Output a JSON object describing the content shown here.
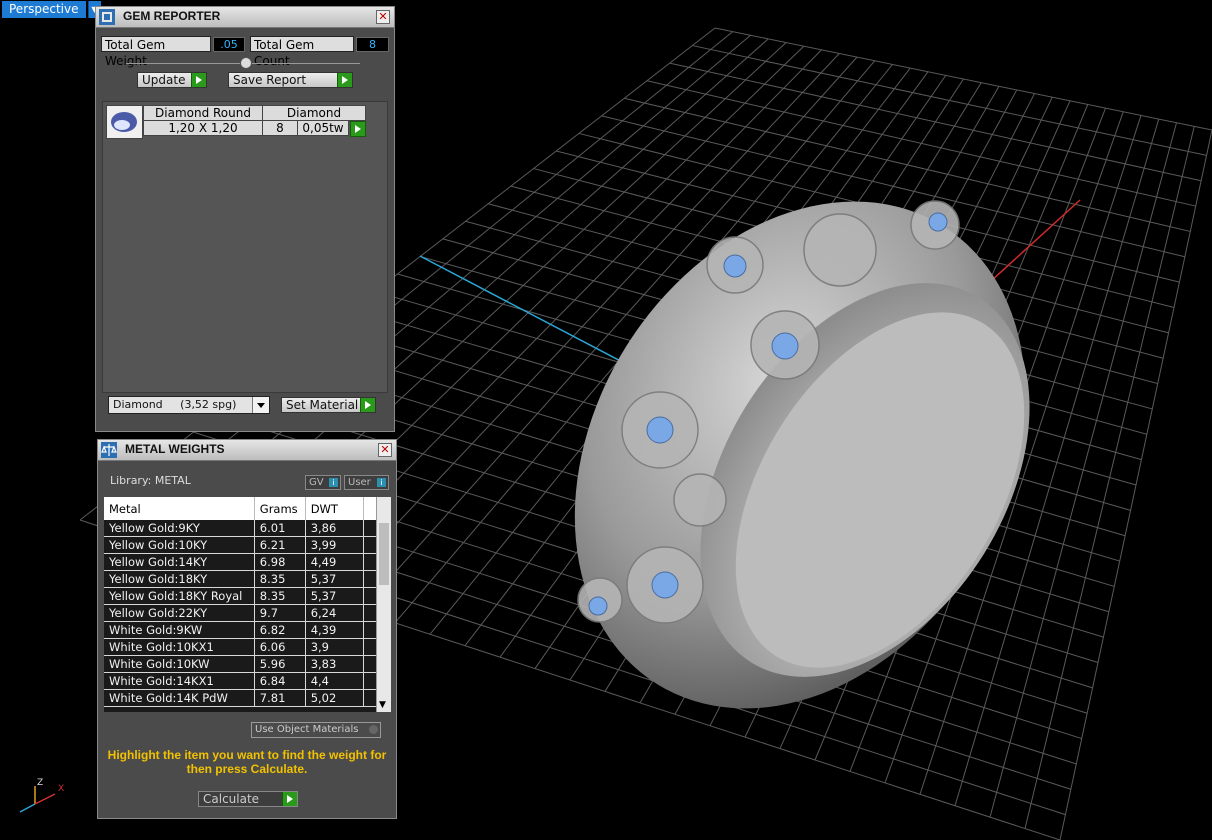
{
  "viewport": {
    "label": "Perspective",
    "axes": {
      "z": "Z",
      "x": "X"
    }
  },
  "gem_reporter": {
    "title": "GEM REPORTER",
    "total_weight_label": "Total Gem Weight",
    "total_weight_value": ".05",
    "total_count_label": "Total Gem Count",
    "total_count_value": "8",
    "update_label": "Update",
    "save_label": "Save Report",
    "gem": {
      "name": "Diamond Round",
      "material": "Diamond",
      "size": "1,20 X 1,20",
      "count": "8",
      "weight": "0,05tw"
    },
    "material_select": "Diamond     (3,52 spg)",
    "set_material_label": "Set Material"
  },
  "metal_weights": {
    "title": "METAL WEIGHTS",
    "library": "Library: METAL",
    "gv": "GV",
    "user": "User",
    "columns": [
      "Metal",
      "Grams",
      "DWT"
    ],
    "rows": [
      [
        "Yellow Gold:9KY",
        "6.01",
        "3,86"
      ],
      [
        "Yellow Gold:10KY",
        "6.21",
        "3,99"
      ],
      [
        "Yellow Gold:14KY",
        "6.98",
        "4,49"
      ],
      [
        "Yellow Gold:18KY",
        "8.35",
        "5,37"
      ],
      [
        "Yellow Gold:18KY Royal",
        "8.35",
        "5,37"
      ],
      [
        "Yellow Gold:22KY",
        "9.7",
        "6,24"
      ],
      [
        "White Gold:9KW",
        "6.82",
        "4,39"
      ],
      [
        "White Gold:10KX1",
        "6.06",
        "3,9"
      ],
      [
        "White Gold:10KW",
        "5.96",
        "3,83"
      ],
      [
        "White Gold:14KX1",
        "6.84",
        "4,4"
      ],
      [
        "White Gold:14K PdW",
        "7.81",
        "5,02"
      ]
    ],
    "use_object_materials": "Use Object Materials",
    "hint": "Highlight the item you want to find the weight for then press Calculate.",
    "calculate_label": "Calculate"
  }
}
